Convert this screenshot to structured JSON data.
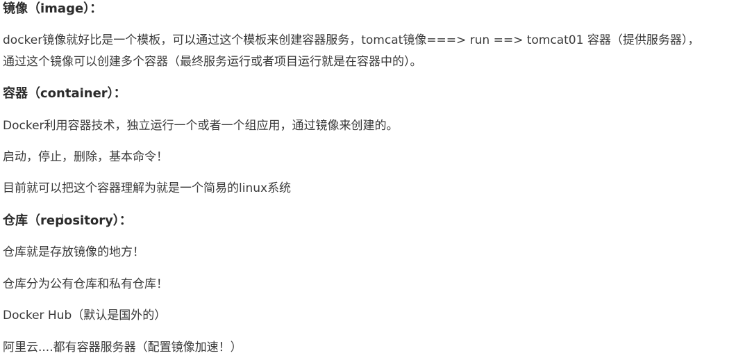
{
  "sections": {
    "image": {
      "heading": "镜像（image）：",
      "lines": [
        "docker镜像就好比是一个模板，可以通过这个模板来创建容器服务，tomcat镜像===> run ==> tomcat01 容器（提供服务器），",
        "通过这个镜像可以创建多个容器（最终服务运行或者项目运行就是在容器中的）。"
      ]
    },
    "container": {
      "heading": "容器（container）：",
      "lines": [
        "Docker利用容器技术，独立运行一个或者一个组应用，通过镜像来创建的。",
        "启动，停止，删除，基本命令！",
        "目前就可以把这个容器理解为就是一个简易的linux系统"
      ]
    },
    "repository": {
      "heading": "仓库（repository）：",
      "lines": [
        "仓库就是存放镜像的地方！",
        "仓库分为公有仓库和私有仓库！",
        "Docker Hub（默认是国外的）",
        "阿里云....都有容器服务器（配置镜像加速！）"
      ]
    }
  }
}
